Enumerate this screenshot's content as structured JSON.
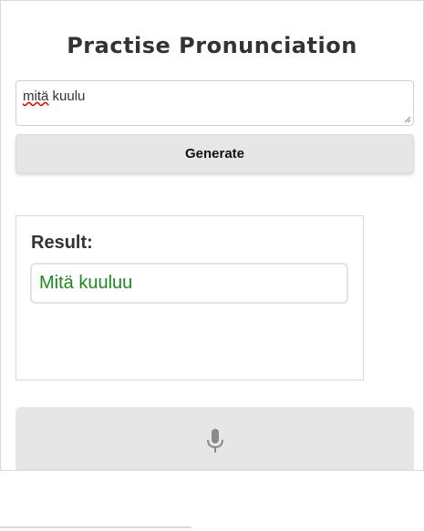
{
  "page": {
    "title": "Practise Pronunciation"
  },
  "input": {
    "value_word1": "mitä",
    "value_rest": " kuulu"
  },
  "generate": {
    "label": "Generate"
  },
  "result": {
    "label": "Result:",
    "text": "Mitä kuuluu",
    "text_color": "#1e8a1e"
  },
  "mic": {
    "icon": "microphone-icon"
  }
}
